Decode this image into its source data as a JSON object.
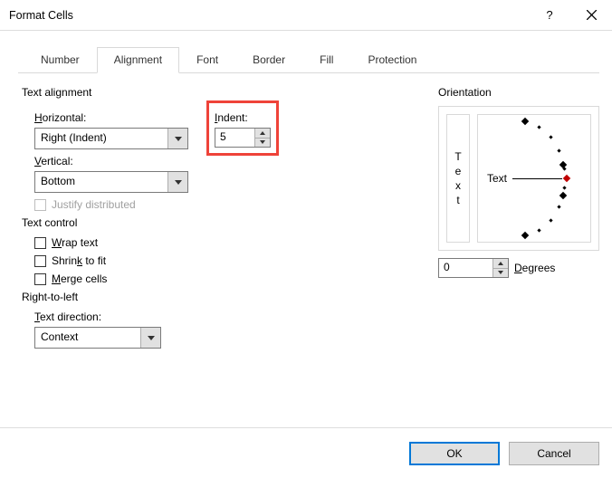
{
  "title": "Format Cells",
  "tabs": {
    "number": "Number",
    "alignment": "Alignment",
    "font": "Font",
    "border": "Border",
    "fill": "Fill",
    "protection": "Protection"
  },
  "alignment": {
    "group_title": "Text alignment",
    "horizontal_label": "Horizontal:",
    "horizontal_value": "Right (Indent)",
    "vertical_label": "Vertical:",
    "vertical_value": "Bottom",
    "indent_label": "Indent:",
    "indent_value": "5",
    "justify_distributed": "Justify distributed"
  },
  "text_control": {
    "group_title": "Text control",
    "wrap": "Wrap text",
    "shrink": "Shrink to fit",
    "merge": "Merge cells"
  },
  "rtl": {
    "group_title": "Right-to-left",
    "direction_label": "Text direction:",
    "direction_value": "Context"
  },
  "orientation": {
    "group_title": "Orientation",
    "vtext": [
      "T",
      "e",
      "x",
      "t"
    ],
    "label": "Text",
    "degrees_value": "0",
    "degrees_label": "Degrees"
  },
  "buttons": {
    "ok": "OK",
    "cancel": "Cancel"
  }
}
